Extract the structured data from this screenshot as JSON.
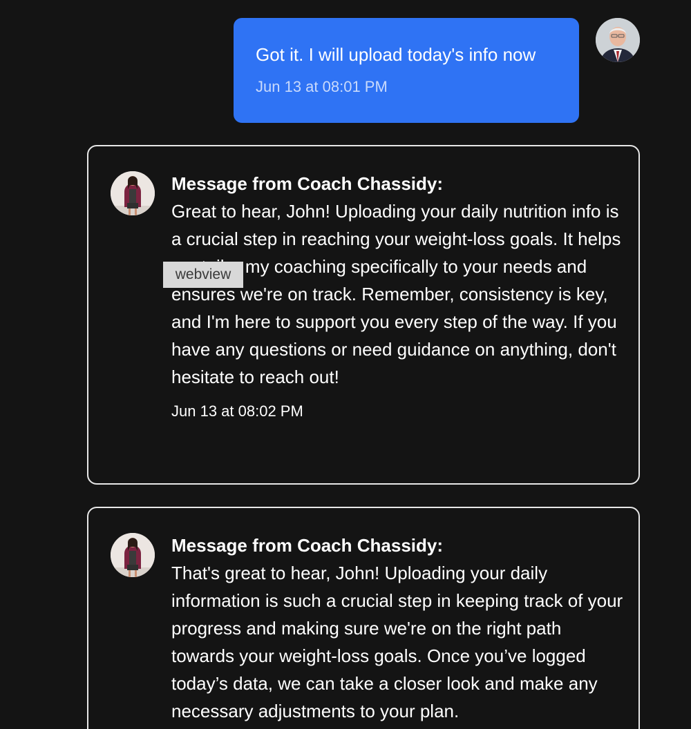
{
  "user_message": {
    "text": "Got it. I will upload today's info now",
    "timestamp": "Jun 13 at 08:01 PM"
  },
  "coach_messages": [
    {
      "heading": "Message from Coach Chassidy:",
      "text": "Great to hear, John! Uploading your daily nutrition info is a crucial step in reaching your weight-loss goals. It helps me tailor my coaching specifically to your needs and ensures we're on track. Remember, consistency is key, and I'm here to support you every step of the way. If you have any questions or need guidance on anything, don't hesitate to reach out!",
      "timestamp": "Jun 13 at 08:02 PM"
    },
    {
      "heading": "Message from Coach Chassidy:",
      "text": "That's great to hear, John! Uploading your daily information is such a crucial step in keeping track of your progress and making sure we're on the right path towards your weight-loss goals. Once you’ve logged today’s data, we can take a closer look and make any necessary adjustments to your plan."
    }
  ],
  "overlay": {
    "webview_label": "webview"
  },
  "colors": {
    "background": "#141414",
    "user_bubble": "#2f73f4",
    "card_border": "#e8e8e8",
    "text": "#ffffff"
  },
  "icons": {
    "user_avatar": "user-avatar-photo",
    "coach_avatar": "coach-avatar-photo"
  }
}
